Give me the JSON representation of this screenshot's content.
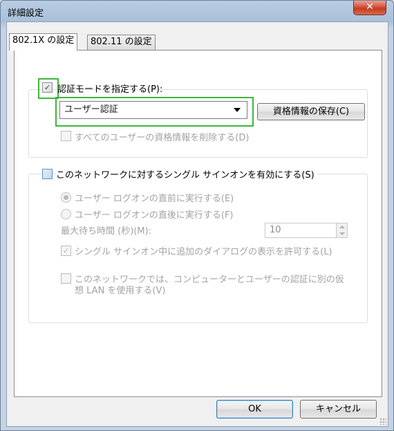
{
  "window": {
    "title": "詳細設定",
    "close_glyph": "✕"
  },
  "tabs": [
    {
      "label": "802.1X の設定",
      "active": true
    },
    {
      "label": "802.11 の設定",
      "active": false
    }
  ],
  "auth_group": {
    "specify_mode_label": "認証モードを指定する(P):",
    "specify_mode_checked": true,
    "mode_select_value": "ユーザー認証",
    "save_credentials_button": "資格情報の保存(C)",
    "delete_credentials_label": "すべてのユーザーの資格情報を削除する(D)",
    "delete_credentials_checked": false
  },
  "sso_group": {
    "enable_sso_label": "このネットワークに対するシングル サインオンを有効にする(S)",
    "enable_sso_checked": false,
    "radio_before_label": "ユーザー ログオンの直前に実行する(E)",
    "radio_after_label": "ユーザー ログオンの直後に実行する(F)",
    "max_wait_label": "最大待ち時間 (秒)(M):",
    "max_wait_value": "10",
    "allow_dialogs_label": "シングル サインオン中に追加のダイアログの表示を許可する(L)",
    "allow_dialogs_checked": true,
    "virtual_lan_label_line1": "このネットワークでは、コンピューターとユーザーの認証に別の仮",
    "virtual_lan_label_line2": "想 LAN を使用する(V)",
    "virtual_lan_checked": false
  },
  "footer": {
    "ok_button": "OK",
    "cancel_button": "キャンセル"
  },
  "colors": {
    "highlight": "#3cb73a",
    "disabled_text": "#a3a3a3"
  }
}
